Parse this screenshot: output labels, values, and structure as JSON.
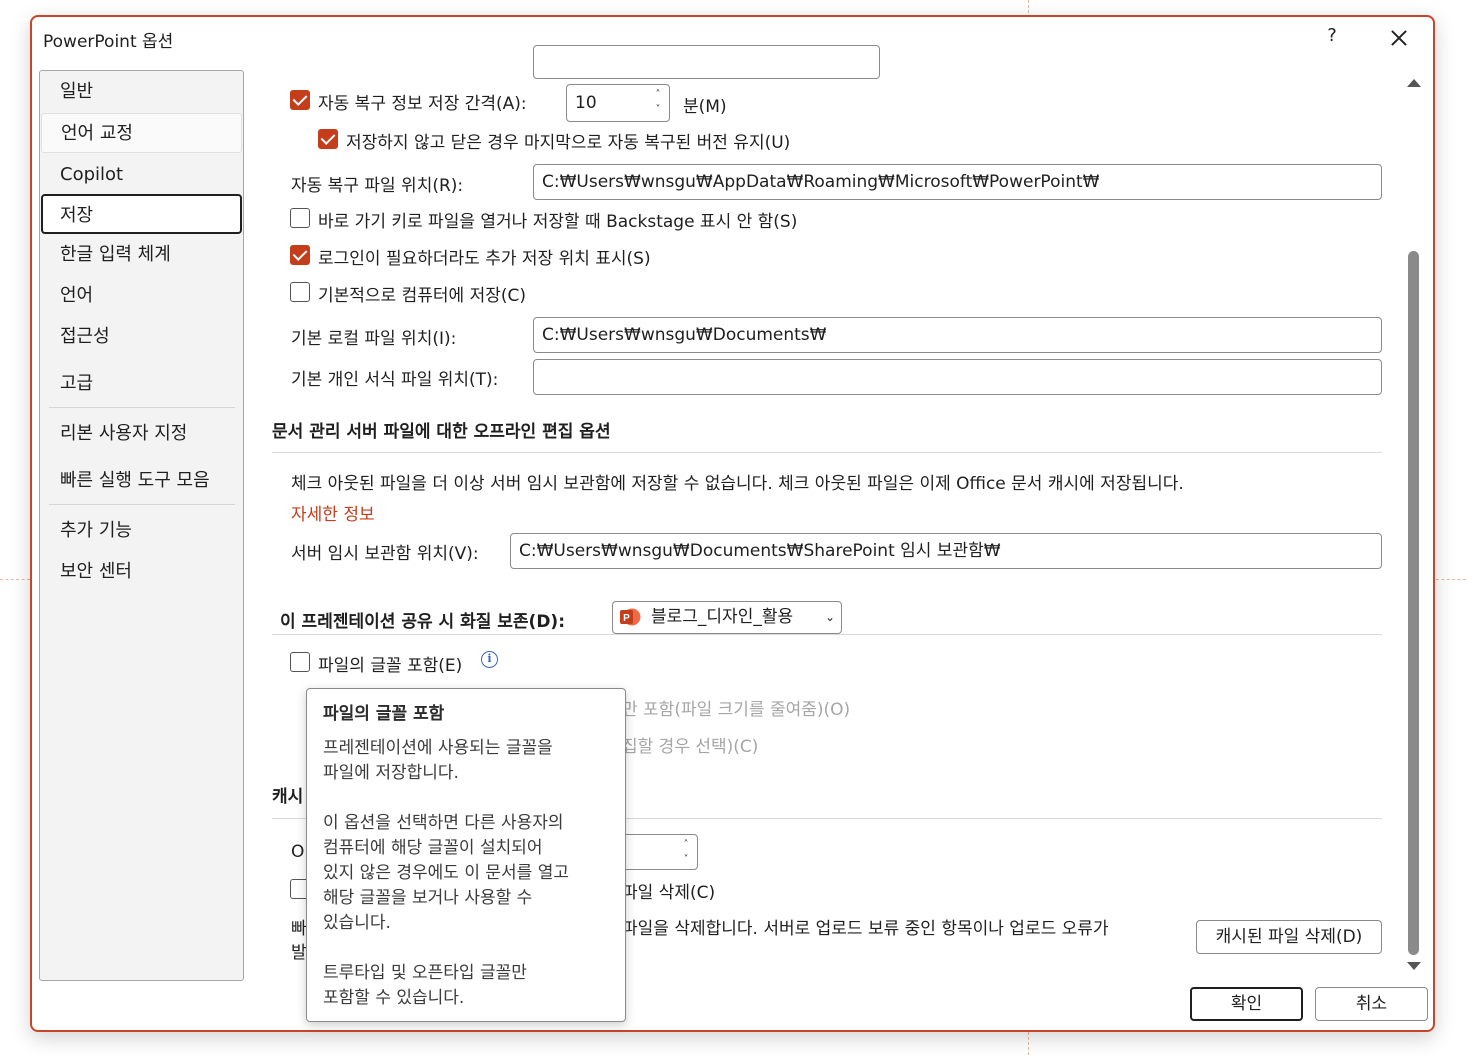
{
  "window": {
    "title": "PowerPoint 옵션",
    "help_label": "?"
  },
  "sidebar": {
    "items": [
      {
        "label": "일반"
      },
      {
        "label": "언어 교정"
      },
      {
        "label": "Copilot"
      },
      {
        "label": "저장"
      },
      {
        "label": "한글 입력 체계"
      },
      {
        "label": "언어"
      },
      {
        "label": "접근성"
      },
      {
        "label": "고급"
      },
      {
        "label": "리본 사용자 지정"
      },
      {
        "label": "빠른 실행 도구 모음"
      },
      {
        "label": "추가 기능"
      },
      {
        "label": "보안 센터"
      }
    ],
    "selected": "저장"
  },
  "save": {
    "autorecover_interval_label": "자동 복구 정보 저장 간격(A):",
    "autorecover_interval_value": "10",
    "autorecover_interval_unit": "분(M)",
    "keep_last_label": "저장하지 않고 닫은 경우 마지막으로 자동 복구된 버전 유지(U)",
    "autorecover_location_label": "자동 복구 파일 위치(R):",
    "autorecover_location_value": "C:₩Users₩wnsgu₩AppData₩Roaming₩Microsoft₩PowerPoint₩",
    "backstage_label": "바로 가기 키로 파일을 열거나 저장할 때 Backstage 표시 안 함(S)",
    "show_additional_label": "로그인이 필요하더라도 추가 저장 위치 표시(S)",
    "save_to_computer_label": "기본적으로 컴퓨터에 저장(C)",
    "local_location_label": "기본 로컬 파일 위치(I):",
    "local_location_value": "C:₩Users₩wnsgu₩Documents₩",
    "template_location_label": "기본 개인 서식 파일 위치(T):",
    "template_location_value": ""
  },
  "offline": {
    "heading": "문서 관리 서버 파일에 대한 오프라인 편집 옵션",
    "description": "체크 아웃된 파일을 더 이상 서버 임시 보관함에 저장할 수 없습니다. 체크 아웃된 파일은 이제 Office 문서 캐시에 저장됩니다.",
    "more_info": "자세한 정보",
    "drafts_label": "서버 임시 보관함 위치(V):",
    "drafts_value": "C:₩Users₩wnsgu₩Documents₩SharePoint 임시 보관함₩"
  },
  "fidelity": {
    "heading": "이 프레젠테이션 공유 시 화질 보존(D):",
    "presentation": "블로그_디자인_활용",
    "embed_fonts_label": "파일의 글꼴 포함(E)",
    "embed_chars_label_partial": "만 포함(파일 크기를 줄여줌)(O)",
    "embed_all_label_partial": "집할 경우 선택)(C)"
  },
  "cache": {
    "heading_partial": "캐시",
    "days_label_partial": "O",
    "delete_closed_label_partial": "파일 삭제(C)",
    "desc_line1_left": "빠",
    "desc_line1_right": "파일을 삭제합니다. 서버로 업로드 보류 중인 항목이나 업로드 오류가",
    "desc_line2_left": "발",
    "delete_button": "캐시된 파일 삭제(D)"
  },
  "tooltip": {
    "title": "파일의 글꼴 포함",
    "p1_l1": "프레젠테이션에 사용되는 글꼴을",
    "p1_l2": "파일에 저장합니다.",
    "p2_l1": "이 옵션을 선택하면 다른 사용자의",
    "p2_l2": "컴퓨터에 해당 글꼴이 설치되어",
    "p2_l3": "있지 않은 경우에도 이 문서를 열고",
    "p2_l4": "해당 글꼴을 보거나 사용할 수",
    "p2_l5": "있습니다.",
    "p3_l1": "트루타입 및 오픈타입 글꼴만",
    "p3_l2": "포함할 수 있습니다."
  },
  "footer": {
    "ok": "확인",
    "cancel": "취소"
  },
  "colors": {
    "accent": "#c43e1c",
    "border": "#c8442a"
  }
}
